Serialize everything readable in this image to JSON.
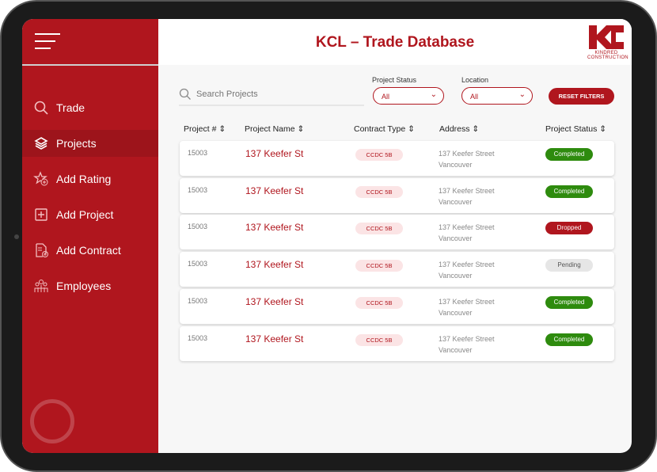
{
  "header": {
    "title": "KCL – Trade Database",
    "logo_text": "KC",
    "logo_subtitle": "KINDRED CONSTRUCTION"
  },
  "sidebar": {
    "items": [
      {
        "label": "Trade",
        "icon": "search-icon"
      },
      {
        "label": "Projects",
        "icon": "layers-icon",
        "active": true
      },
      {
        "label": "Add Rating",
        "icon": "star-plus-icon"
      },
      {
        "label": "Add Project",
        "icon": "square-plus-icon"
      },
      {
        "label": "Add Contract",
        "icon": "document-plus-icon"
      },
      {
        "label": "Employees",
        "icon": "people-icon"
      }
    ]
  },
  "filters": {
    "search_placeholder": "Search Projects",
    "status_label": "Project Status",
    "status_value": "All",
    "location_label": "Location",
    "location_value": "All",
    "reset_label": "RESET FILTERS"
  },
  "table": {
    "headers": [
      "Project # ⇕",
      "Project Name ⇕",
      "Contract Type ⇕",
      "Address ⇕",
      "Project Status ⇕"
    ],
    "rows": [
      {
        "num": "15003",
        "name": "137 Keefer St",
        "contract": "CCDC 5B",
        "street": "137 Keefer Street",
        "city": "Vancouver",
        "status": "Completed"
      },
      {
        "num": "15003",
        "name": "137 Keefer St",
        "contract": "CCDC 5B",
        "street": "137 Keefer Street",
        "city": "Vancouver",
        "status": "Completed"
      },
      {
        "num": "15003",
        "name": "137 Keefer St",
        "contract": "CCDC 5B",
        "street": "137 Keefer Street",
        "city": "Vancouver",
        "status": "Dropped"
      },
      {
        "num": "15003",
        "name": "137 Keefer St",
        "contract": "CCDC 5B",
        "street": "137 Keefer Street",
        "city": "Vancouver",
        "status": "Pending"
      },
      {
        "num": "15003",
        "name": "137 Keefer St",
        "contract": "CCDC 5B",
        "street": "137 Keefer Street",
        "city": "Vancouver",
        "status": "Completed"
      },
      {
        "num": "15003",
        "name": "137 Keefer St",
        "contract": "CCDC 5B",
        "street": "137 Keefer Street",
        "city": "Vancouver",
        "status": "Completed"
      }
    ]
  },
  "colors": {
    "brand": "#b0161e",
    "completed": "#2e8b0e",
    "dropped": "#b0161e",
    "pending": "#e6e6e6"
  }
}
